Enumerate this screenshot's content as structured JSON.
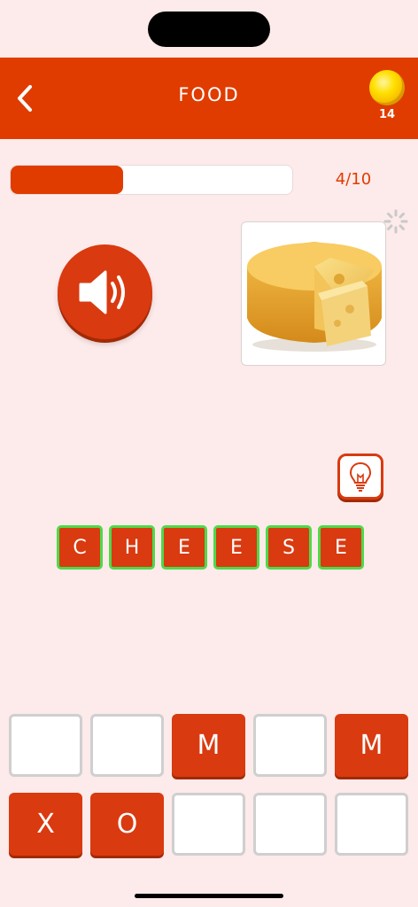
{
  "header": {
    "title": "FOOD",
    "coins": "14",
    "icons": {
      "back": "chevron-left-icon",
      "coin": "coin-icon"
    },
    "colors": {
      "background": "#e03c00",
      "text": "#ffffff"
    }
  },
  "progress": {
    "label": "4/10",
    "fraction": 0.4,
    "colors": {
      "fill": "#e03c00",
      "track": "#ffffff"
    }
  },
  "question": {
    "sound_icon": "speaker-icon",
    "image_alt": "cheese",
    "hint_icon": "lightbulb-icon"
  },
  "answer": {
    "letters": [
      "C",
      "H",
      "E",
      "E",
      "S",
      "E"
    ],
    "colors": {
      "tile": "#d93a10",
      "border": "#4fd94a"
    }
  },
  "keyboard": {
    "keys": [
      "",
      "",
      "M",
      "",
      "M",
      "X",
      "O",
      "",
      "",
      ""
    ],
    "colors": {
      "filled": "#d93a10",
      "empty": "#ffffff"
    }
  }
}
